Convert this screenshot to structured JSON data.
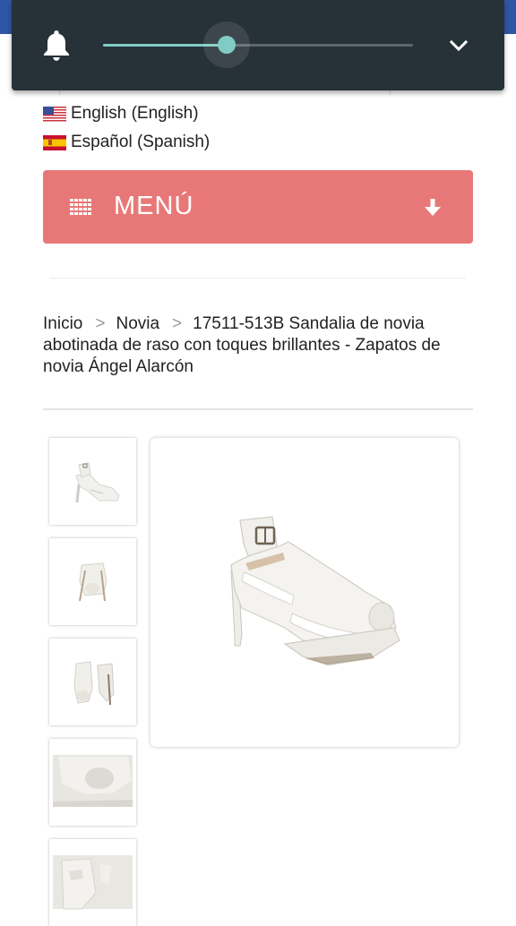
{
  "volume": {
    "level_percent": 40
  },
  "languages": [
    {
      "label": "English (English)",
      "flag": "us-flag-icon"
    },
    {
      "label": "Español (Spanish)",
      "flag": "spain-flag-icon"
    }
  ],
  "menu": {
    "label": "MENÚ",
    "color": "#e87878"
  },
  "breadcrumb": {
    "items": [
      "Inicio",
      "Novia"
    ],
    "separator": ">",
    "current": "17511-513B Sandalia de novia abotinada de raso con toques brillantes - Zapatos de novia Ángel Alarcón"
  },
  "colors": {
    "header_blue": "#2f56a6",
    "volume_panel": "#263238",
    "slider_accent": "#80cbc4"
  }
}
